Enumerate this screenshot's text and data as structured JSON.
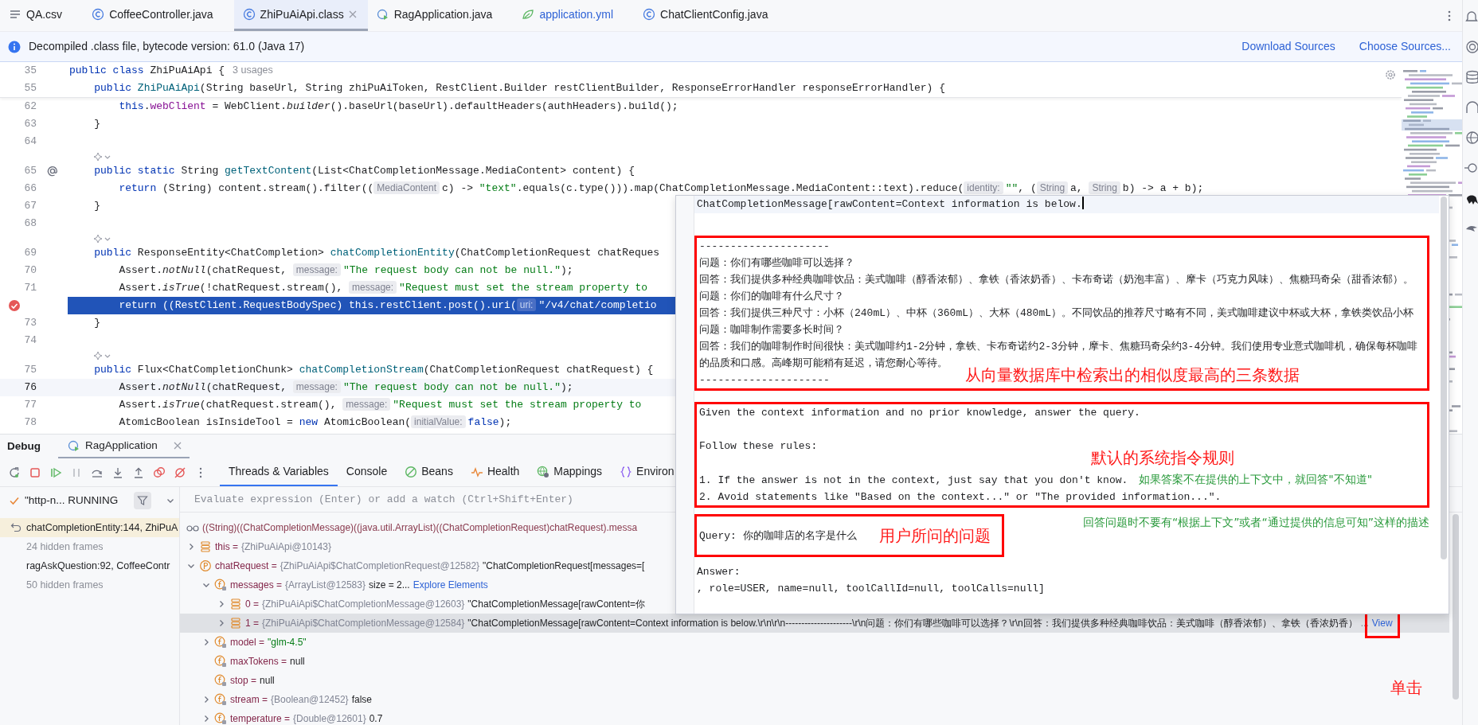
{
  "tabs": [
    {
      "label": "QA.csv",
      "kind": "list",
      "selected": false,
      "color": "#1e1f22"
    },
    {
      "label": "CoffeeController.java",
      "kind": "class",
      "selected": false,
      "color": "#1e1f22"
    },
    {
      "label": "ZhiPuAiApi.class",
      "kind": "class",
      "selected": true,
      "color": "#1e1f22"
    },
    {
      "label": "RagApplication.java",
      "kind": "app",
      "selected": false,
      "color": "#1e1f22"
    },
    {
      "label": "application.yml",
      "kind": "leaf",
      "selected": false,
      "color": "#2f63d6"
    },
    {
      "label": "ChatClientConfig.java",
      "kind": "class",
      "selected": false,
      "color": "#1e1f22"
    }
  ],
  "notice": {
    "text": "Decompiled .class file, bytecode version: 61.0 (Java 17)",
    "links": [
      "Download Sources",
      "Choose Sources..."
    ]
  },
  "editor": {
    "sticky": [
      {
        "kind": "code",
        "number": "35",
        "segments": [
          {
            "kind": "kw",
            "text": "public class "
          },
          {
            "kind": "plain",
            "text": "ZhiPuAiApi {"
          },
          {
            "kind": "usage",
            "text": "3 usages"
          }
        ]
      },
      {
        "kind": "code",
        "number": "55",
        "segments": [
          {
            "kind": "kw",
            "text": "    public "
          },
          {
            "kind": "fn",
            "text": "ZhiPuAiApi"
          },
          {
            "kind": "plain",
            "text": "(String baseUrl, String zhiPuAiToken, RestClient.Builder restClientBuilder, ResponseErrorHandler responseErrorHandler) {"
          }
        ]
      }
    ],
    "rows": [
      {
        "kind": "code",
        "number": "62",
        "segments": [
          {
            "kind": "kw",
            "text": "        this"
          },
          {
            "kind": "plain",
            "text": "."
          },
          {
            "kind": "field",
            "text": "webClient"
          },
          {
            "kind": "plain",
            "text": " = WebClient."
          },
          {
            "kind": "italic",
            "text": "builder"
          },
          {
            "kind": "plain",
            "text": "().baseUrl(baseUrl).defaultHeaders(authHeaders).build();"
          }
        ]
      },
      {
        "kind": "code",
        "number": "63",
        "segments": [
          {
            "kind": "plain",
            "text": "    }"
          }
        ]
      },
      {
        "kind": "code",
        "number": "64"
      },
      {
        "kind": "vision"
      },
      {
        "kind": "code",
        "number": "65",
        "annotation_marker": true,
        "segments": [
          {
            "kind": "kw",
            "text": "    public static "
          },
          {
            "kind": "plain",
            "text": "String "
          },
          {
            "kind": "fn",
            "text": "getTextContent"
          },
          {
            "kind": "plain",
            "text": "(List<ChatCompletionMessage.MediaContent> content) {"
          }
        ]
      },
      {
        "kind": "code",
        "number": "66",
        "segments": [
          {
            "kind": "kw",
            "text": "        return "
          },
          {
            "kind": "plain",
            "text": "(String) content.stream().filter(("
          },
          {
            "kind": "hint",
            "text": "MediaContent"
          },
          {
            "kind": "plain",
            "text": "c) -> "
          },
          {
            "kind": "str",
            "text": "\"text\""
          },
          {
            "kind": "plain",
            "text": ".equals(c.type())).map(ChatCompletionMessage.MediaContent::text).reduce("
          },
          {
            "kind": "hint",
            "text": "identity:"
          },
          {
            "kind": "str",
            "text": "\"\""
          },
          {
            "kind": "plain",
            "text": ", ("
          },
          {
            "kind": "hint",
            "text": "String"
          },
          {
            "kind": "plain",
            "text": "a, "
          },
          {
            "kind": "hint",
            "text": "String"
          },
          {
            "kind": "plain",
            "text": "b) -> a + b);"
          }
        ]
      },
      {
        "kind": "code",
        "number": "67",
        "segments": [
          {
            "kind": "plain",
            "text": "    }"
          }
        ]
      },
      {
        "kind": "code",
        "number": "68"
      },
      {
        "kind": "vision"
      },
      {
        "kind": "code",
        "number": "69",
        "segments": [
          {
            "kind": "kw",
            "text": "    public "
          },
          {
            "kind": "plain",
            "text": "ResponseEntity<ChatCompletion> "
          },
          {
            "kind": "fn",
            "text": "chatCompletionEntity"
          },
          {
            "kind": "plain",
            "text": "(ChatCompletionRequest chatReques"
          }
        ]
      },
      {
        "kind": "code",
        "number": "70",
        "segments": [
          {
            "kind": "plain",
            "text": "        Assert."
          },
          {
            "kind": "italic",
            "text": "notNull"
          },
          {
            "kind": "plain",
            "text": "(chatRequest, "
          },
          {
            "kind": "hint",
            "text": "message:"
          },
          {
            "kind": "str",
            "text": "\"The request body can not be null.\""
          },
          {
            "kind": "plain",
            "text": ");"
          }
        ]
      },
      {
        "kind": "code",
        "number": "71",
        "segments": [
          {
            "kind": "plain",
            "text": "        Assert."
          },
          {
            "kind": "italic",
            "text": "isTrue"
          },
          {
            "kind": "plain",
            "text": "(!chatRequest.stream(), "
          },
          {
            "kind": "hint",
            "text": "message:"
          },
          {
            "kind": "str",
            "text": "\"Request must set the stream property to"
          }
        ]
      },
      {
        "kind": "code",
        "breakpoint": true,
        "execution_point": true,
        "segments": [
          {
            "kind": "kw",
            "text": "        return "
          },
          {
            "kind": "plain",
            "text": "((RestClient.RequestBodySpec) this.restClient.post().uri("
          },
          {
            "kind": "hint",
            "text": "uri:"
          },
          {
            "kind": "str",
            "text": "\"/v4/chat/completio"
          }
        ]
      },
      {
        "kind": "code",
        "number": "73",
        "segments": [
          {
            "kind": "plain",
            "text": "    }"
          }
        ]
      },
      {
        "kind": "code",
        "number": "74"
      },
      {
        "kind": "vision"
      },
      {
        "kind": "code",
        "number": "75",
        "segments": [
          {
            "kind": "kw",
            "text": "    public "
          },
          {
            "kind": "plain",
            "text": "Flux<ChatCompletionChunk> "
          },
          {
            "kind": "fn",
            "text": "chatCompletionStream"
          },
          {
            "kind": "plain",
            "text": "(ChatCompletionRequest chatRequest) {"
          }
        ]
      },
      {
        "kind": "code",
        "number": "76",
        "caret_line": true,
        "segments": [
          {
            "kind": "plain",
            "text": "        Assert."
          },
          {
            "kind": "italic",
            "text": "notNull"
          },
          {
            "kind": "plain",
            "text": "(chatRequest, "
          },
          {
            "kind": "hint",
            "text": "message:"
          },
          {
            "kind": "str",
            "text": "\"The request body can not be null.\""
          },
          {
            "kind": "plain",
            "text": ");"
          }
        ]
      },
      {
        "kind": "code",
        "number": "77",
        "segments": [
          {
            "kind": "plain",
            "text": "        Assert."
          },
          {
            "kind": "italic",
            "text": "isTrue"
          },
          {
            "kind": "plain",
            "text": "(chatRequest.stream(), "
          },
          {
            "kind": "hint",
            "text": "message:"
          },
          {
            "kind": "str",
            "text": "\"Request must set the stream property to"
          }
        ]
      },
      {
        "kind": "code",
        "number": "78",
        "segments": [
          {
            "kind": "plain",
            "text": "        AtomicBoolean isInsideTool = "
          },
          {
            "kind": "kw",
            "text": "new "
          },
          {
            "kind": "plain",
            "text": "AtomicBoolean("
          },
          {
            "kind": "hint",
            "text": "initialValue:"
          },
          {
            "kind": "kw",
            "text": "false"
          },
          {
            "kind": "plain",
            "text": ");"
          }
        ]
      }
    ]
  },
  "debug": {
    "title": "Debug",
    "session": "RagApplication",
    "tabs": [
      {
        "label": "Threads & Variables",
        "kind": "plain",
        "selected": true
      },
      {
        "label": "Console",
        "kind": "plain",
        "selected": false
      },
      {
        "label": "Beans",
        "kind": "beans",
        "selected": false
      },
      {
        "label": "Health",
        "kind": "health",
        "selected": false
      },
      {
        "label": "Mappings",
        "kind": "mappings",
        "selected": false
      },
      {
        "label": "Environ",
        "kind": "environment",
        "selected": false
      }
    ],
    "thread": "\"http-n... RUNNING",
    "frames": [
      {
        "text": "chatCompletionEntity:144, ZhiPuA",
        "kind": "frame",
        "selected": true
      },
      {
        "text": "24 hidden frames",
        "kind": "hidden",
        "selected": false
      },
      {
        "text": "ragAskQuestion:92, CoffeeContr",
        "kind": "frame",
        "selected": false
      },
      {
        "text": "50 hidden frames",
        "kind": "hidden",
        "selected": false
      }
    ],
    "evaluate": {
      "placeholder": "Evaluate expression (Enter) or add a watch (Ctrl+Shift+Enter)"
    },
    "variables": [
      {
        "kind": "watch",
        "name": "((String)((ChatCompletionMessage)((java.util.ArrayList)((ChatCompletionRequest)chatRequest).messa",
        "selected": false
      },
      {
        "kind": "object",
        "name": "this =",
        "type": "{ZhiPuAiApi@10143}",
        "expanded": false,
        "selected": false
      },
      {
        "kind": "param",
        "name": "chatRequest =",
        "type": "{ZhiPuAiApi$ChatCompletionRequest@12582}",
        "value": "\"ChatCompletionRequest[messages=[",
        "expanded": true,
        "selected": false,
        "children": [
          {
            "kind": "field",
            "name": "messages =",
            "type": "{ArrayList@12583}",
            "value": "size = 2...",
            "link": "Explore Elements",
            "expanded": true,
            "selected": false,
            "children": [
              {
                "kind": "object",
                "name": "0 =",
                "type": "{ZhiPuAiApi$ChatCompletionMessage@12603}",
                "value": "\"ChatCompletionMessage[rawContent=你",
                "expanded": false,
                "selected": false
              },
              {
                "kind": "object",
                "name": "1 =",
                "type": "{ZhiPuAiApi$ChatCompletionMessage@12584}",
                "value": "\"ChatCompletionMessage[rawContent=Context information is below.\\r\\n\\r\\n---------------------\\r\\n问题：你们有哪些咖啡可以选择？\\r\\n回答：我们提供多种经典咖啡饮品：美式咖啡（醇香浓郁）、拿铁（香浓奶香）",
                "more": "...",
                "link": "View",
                "expanded": false,
                "selected": true
              }
            ]
          },
          {
            "kind": "field",
            "name": "model =",
            "value": "\"glm-4.5\"",
            "string_value": true,
            "expanded": false,
            "selected": false
          },
          {
            "kind": "field",
            "name": "maxTokens =",
            "value": "null",
            "selected": false
          },
          {
            "kind": "field",
            "name": "stop =",
            "value": "null",
            "selected": false
          },
          {
            "kind": "field",
            "name": "stream =",
            "type": "{Boolean@12452}",
            "value": "false",
            "expanded": false,
            "selected": false
          },
          {
            "kind": "field",
            "name": "temperature =",
            "type": "{Double@12601}",
            "value": "0.7",
            "expanded": false,
            "selected": false
          }
        ]
      }
    ],
    "click_note": {
      "text": "单击",
      "color": "#ff1a1a"
    }
  },
  "popup": {
    "sections": [
      {
        "boxed": false,
        "lines": [
          {
            "kind": "text",
            "text": "ChatCompletionMessage[rawContent=Context information is below.",
            "cursor": true
          },
          {
            "kind": "blank"
          }
        ]
      },
      {
        "boxed": true,
        "note": {
          "text": "从向量数据库中检索出的相似度最高的三条数据",
          "color": "#ff1a1a"
        },
        "lines": [
          {
            "kind": "text",
            "text": "---------------------"
          },
          {
            "kind": "text",
            "text": "问题：你们有哪些咖啡可以选择？"
          },
          {
            "kind": "text",
            "text": "回答：我们提供多种经典咖啡饮品：美式咖啡（醇香浓郁）、拿铁（香浓奶香）、卡布奇诺（奶泡丰富）、摩卡（巧克力风味）、焦糖玛奇朵（甜香浓郁）。"
          },
          {
            "kind": "text",
            "text": "问题：你们的咖啡有什么尺寸？"
          },
          {
            "kind": "text",
            "text": "回答：我们提供三种尺寸：小杯（240mL）、中杯（360mL）、大杯（480mL）。不同饮品的推荐尺寸略有不同，美式咖啡建议中杯或大杯，拿铁类饮品小杯"
          },
          {
            "kind": "text",
            "text": "问题：咖啡制作需要多长时间？"
          },
          {
            "kind": "text",
            "text": "回答：我们的咖啡制作时间很快：美式咖啡约1-2分钟，拿铁、卡布奇诺约2-3分钟，摩卡、焦糖玛奇朵约3-4分钟。我们使用专业意式咖啡机，确保每杯咖啡的品质和口感。高峰期可能稍有延迟，请您耐心等待。"
          },
          {
            "kind": "text",
            "text": "---------------------"
          }
        ]
      },
      {
        "boxed": true,
        "note": {
          "text": "默认的系统指令规则",
          "color": "#ff1a1a"
        },
        "lines": [
          {
            "kind": "text",
            "text": "Given the context information and no prior knowledge, answer the query."
          },
          {
            "kind": "blank"
          },
          {
            "kind": "text",
            "text": "Follow these rules:"
          },
          {
            "kind": "blank"
          },
          {
            "kind": "text",
            "text": "1. If the answer is not in the context, just say that you don't know.",
            "note": {
              "text": "如果答案不在提供的上下文中，就回答\"不知道\"",
              "color": "#2a9a3c"
            }
          },
          {
            "kind": "text",
            "text": "2. Avoid statements like \"Based on the context...\" or \"The provided information...\"."
          }
        ]
      },
      {
        "boxed": true,
        "inline_note": {
          "text": "用户所问的问题",
          "color": "#ff1a1a"
        },
        "side_note": {
          "text": "回答问题时不要有“根据上下文”或者“通过提供的信息可知”这样的描述",
          "color": "#2a9a3c"
        },
        "lines": [
          {
            "kind": "text",
            "text": "Query: 你的咖啡店的名字是什么"
          }
        ]
      },
      {
        "boxed": false,
        "lines": [
          {
            "kind": "text",
            "text": "Answer:"
          },
          {
            "kind": "text",
            "text": ", role=USER, name=null, toolCallId=null, toolCalls=null]"
          }
        ]
      }
    ]
  }
}
